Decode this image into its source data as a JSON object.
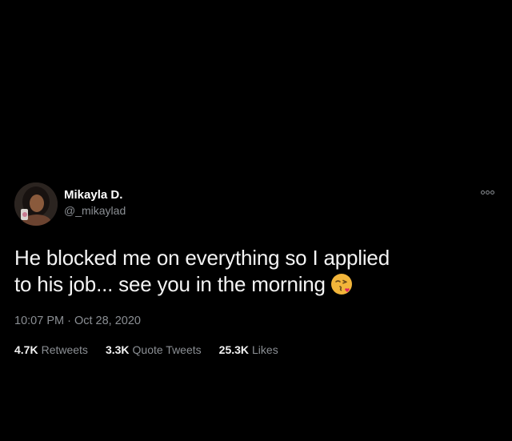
{
  "tweet": {
    "display_name": "Mikayla D.",
    "handle": "@_mikaylad",
    "text_line1": "He blocked me on everything so I applied",
    "text_line2": "to his job... see you in the morning",
    "emoji": "face-blowing-a-kiss-icon",
    "timestamp": "10:07 PM · Oct 28, 2020",
    "stats": {
      "retweets_count": "4.7K",
      "retweets_label": "Retweets",
      "quotes_count": "3.3K",
      "quotes_label": "Quote Tweets",
      "likes_count": "25.3K",
      "likes_label": "Likes"
    }
  },
  "colors": {
    "background": "#000000",
    "primary_text": "#ffffff",
    "secondary_text": "#8b8f94"
  }
}
